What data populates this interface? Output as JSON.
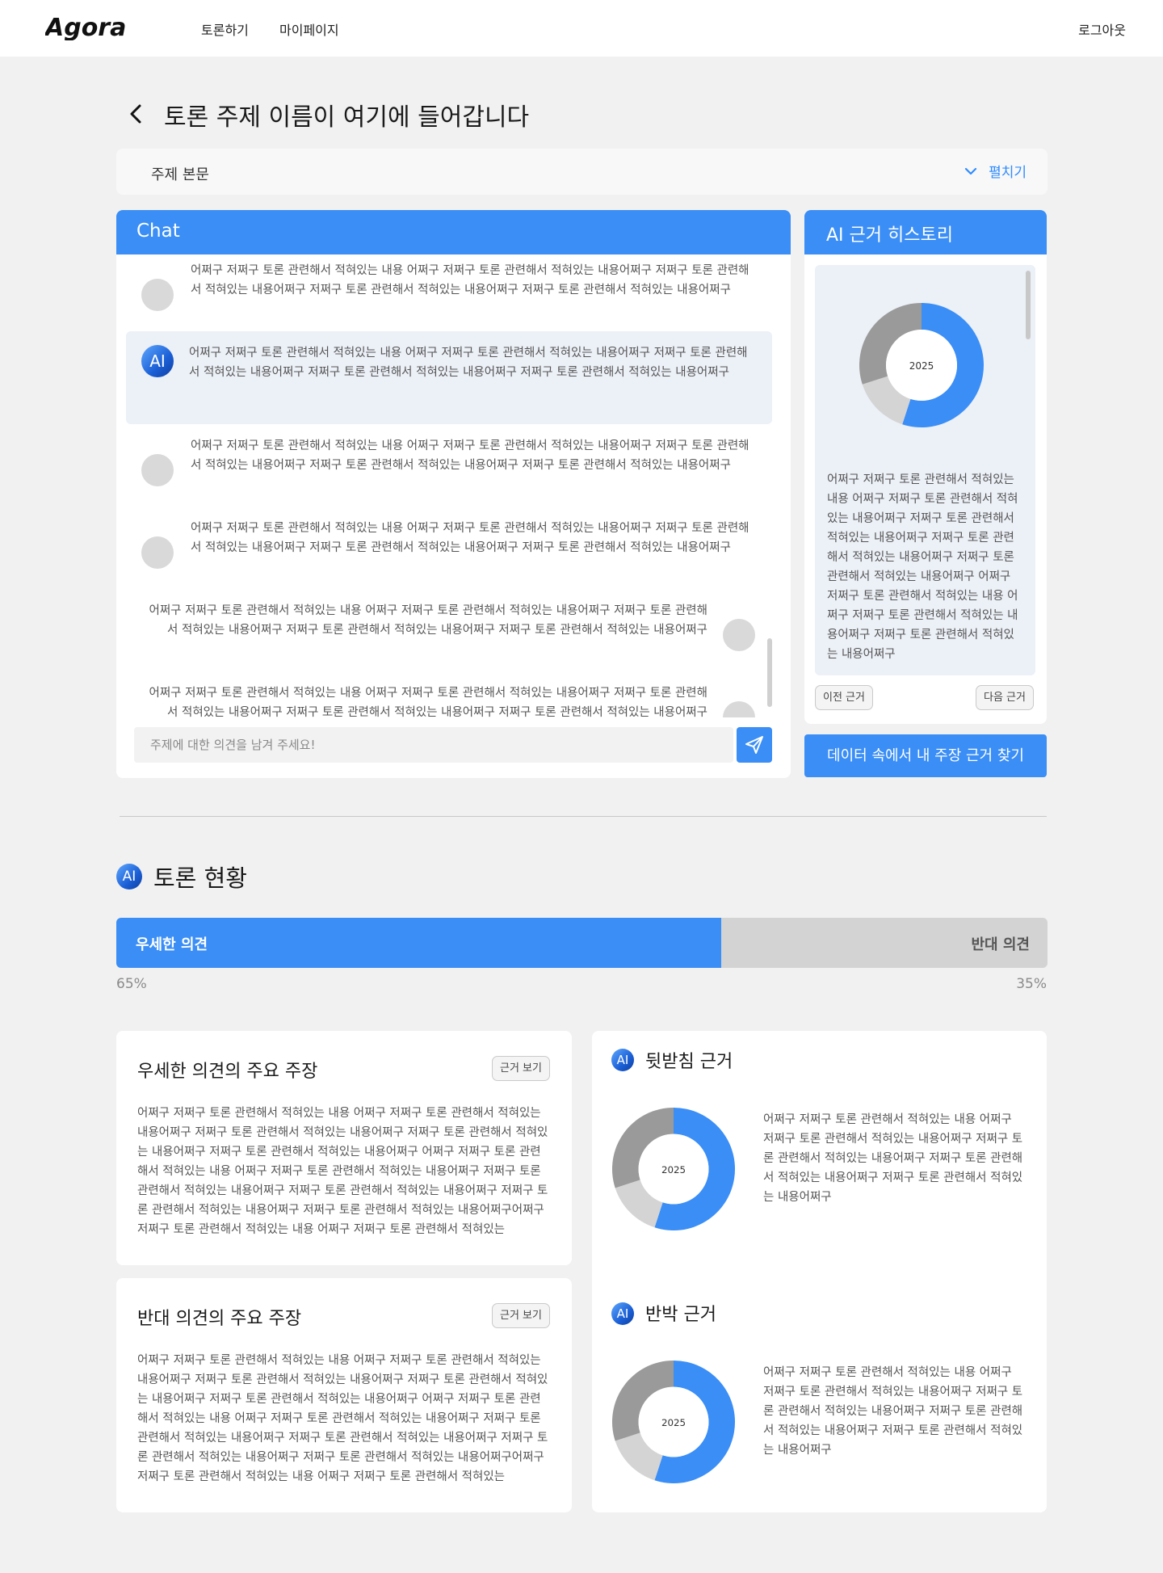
{
  "header": {
    "logo_text": "Agora",
    "nav": [
      "토론하기",
      "마이페이지"
    ],
    "logout": "로그아웃"
  },
  "page": {
    "title": "토론 주제 이름이 여기에 들어갑니다",
    "topic_label": "주제 본문",
    "expand_label": "펼치기"
  },
  "chat": {
    "title": "Chat",
    "ai_badge": "AI",
    "messages": [
      {
        "side": "left",
        "text": "어쩌구 저쩌구 토론 관련해서 적혀있는 내용 어쩌구 저쩌구 토론 관련해서 적혀있는 내용어쩌구 저쩌구 토론 관련해서 적혀있는 내용어쩌구 저쩌구 토론 관련해서 적혀있는 내용어쩌구 저쩌구 토론 관련해서 적혀있는 내용어쩌구"
      },
      {
        "side": "ai",
        "text": "어쩌구 저쩌구 토론 관련해서 적혀있는 내용 어쩌구 저쩌구 토론 관련해서 적혀있는 내용어쩌구 저쩌구 토론 관련해서 적혀있는 내용어쩌구 저쩌구 토론 관련해서 적혀있는 내용어쩌구 저쩌구 토론 관련해서 적혀있는 내용어쩌구"
      },
      {
        "side": "left",
        "text": "어쩌구 저쩌구 토론 관련해서 적혀있는 내용 어쩌구 저쩌구 토론 관련해서 적혀있는 내용어쩌구 저쩌구 토론 관련해서 적혀있는 내용어쩌구 저쩌구 토론 관련해서 적혀있는 내용어쩌구 저쩌구 토론 관련해서 적혀있는 내용어쩌구"
      },
      {
        "side": "left",
        "text": "어쩌구 저쩌구 토론 관련해서 적혀있는 내용 어쩌구 저쩌구 토론 관련해서 적혀있는 내용어쩌구 저쩌구 토론 관련해서 적혀있는 내용어쩌구 저쩌구 토론 관련해서 적혀있는 내용어쩌구 저쩌구 토론 관련해서 적혀있는 내용어쩌구"
      },
      {
        "side": "right",
        "text": "어쩌구 저쩌구 토론 관련해서 적혀있는 내용 어쩌구 저쩌구 토론 관련해서 적혀있는 내용어쩌구 저쩌구 토론 관련해서 적혀있는 내용어쩌구 저쩌구 토론 관련해서 적혀있는 내용어쩌구 저쩌구 토론 관련해서 적혀있는 내용어쩌구"
      },
      {
        "side": "right",
        "text": "어쩌구 저쩌구 토론 관련해서 적혀있는 내용 어쩌구 저쩌구 토론 관련해서 적혀있는 내용어쩌구 저쩌구 토론 관련해서 적혀있는 내용어쩌구 저쩌구 토론 관련해서 적혀있는 내용어쩌구 저쩌구 토론 관련해서 적혀있는 내용어쩌구"
      }
    ],
    "input_placeholder": "주제에 대한 의견을 남겨 주세요!",
    "send_icon": "send-icon"
  },
  "history": {
    "title": "AI 근거 히스토리",
    "chart_label": "2025",
    "text": "어쩌구 저쩌구 토론 관련해서 적혀있는 내용 어쩌구 저쩌구 토론 관련해서 적혀있는 내용어쩌구 저쩌구 토론 관련해서 적혀있는 내용어쩌구 저쩌구 토론 관련해서 적혀있는 내용어쩌구 저쩌구 토론 관련해서 적혀있는 내용어쩌구 어쩌구 저쩌구 토론 관련해서 적혀있는 내용 어쩌구 저쩌구 토론 관련해서 적혀있는 내용어쩌구 저쩌구 토론 관련해서 적혀있는 내용어쩌구",
    "prev_label": "이전 근거",
    "next_label": "다음 근거",
    "find_button": "데이터 속에서 내 주장 근거 찾기"
  },
  "status": {
    "ai_badge": "AI",
    "title": "토론 현황",
    "dominant_label": "우세한 의견",
    "opposing_label": "반대 의견",
    "dominant_pct": "65%",
    "opposing_pct": "35%",
    "dominant_fraction": 0.65
  },
  "claims": [
    {
      "title": "우세한 의견의 주요 주장",
      "button": "근거 보기",
      "text": "어쩌구 저쩌구 토론 관련해서 적혀있는 내용 어쩌구 저쩌구 토론 관련해서 적혀있는 내용어쩌구 저쩌구 토론 관련해서 적혀있는 내용어쩌구 저쩌구 토론 관련해서 적혀있는 내용어쩌구 저쩌구 토론 관련해서 적혀있는 내용어쩌구 어쩌구 저쩌구 토론 관련해서 적혀있는 내용 어쩌구 저쩌구 토론 관련해서 적혀있는 내용어쩌구 저쩌구 토론 관련해서 적혀있는 내용어쩌구 저쩌구 토론 관련해서 적혀있는 내용어쩌구 저쩌구 토론 관련해서 적혀있는 내용어쩌구 저쩌구 토론 관련해서 적혀있는 내용어쩌구어쩌구 저쩌구 토론 관련해서 적혀있는 내용 어쩌구 저쩌구 토론 관련해서 적혀있는"
    },
    {
      "title": "반대 의견의 주요 주장",
      "button": "근거 보기",
      "text": "어쩌구 저쩌구 토론 관련해서 적혀있는 내용 어쩌구 저쩌구 토론 관련해서 적혀있는 내용어쩌구 저쩌구 토론 관련해서 적혀있는 내용어쩌구 저쩌구 토론 관련해서 적혀있는 내용어쩌구 저쩌구 토론 관련해서 적혀있는 내용어쩌구 어쩌구 저쩌구 토론 관련해서 적혀있는 내용 어쩌구 저쩌구 토론 관련해서 적혀있는 내용어쩌구 저쩌구 토론 관련해서 적혀있는 내용어쩌구 저쩌구 토론 관련해서 적혀있는 내용어쩌구 저쩌구 토론 관련해서 적혀있는 내용어쩌구 저쩌구 토론 관련해서 적혀있는 내용어쩌구어쩌구 저쩌구 토론 관련해서 적혀있는 내용 어쩌구 저쩌구 토론 관련해서 적혀있는"
    }
  ],
  "evidence": [
    {
      "ai_badge": "AI",
      "title": "뒷받침 근거",
      "chart_label": "2025",
      "text": "어쩌구 저쩌구 토론 관련해서 적혀있는 내용 어쩌구 저쩌구 토론 관련해서 적혀있는 내용어쩌구 저쩌구 토론 관련해서 적혀있는 내용어쩌구 저쩌구 토론 관련해서 적혀있는 내용어쩌구 저쩌구 토론 관련해서 적혀있는 내용어쩌구"
    },
    {
      "ai_badge": "AI",
      "title": "반박 근거",
      "chart_label": "2025",
      "text": "어쩌구 저쩌구 토론 관련해서 적혀있는 내용 어쩌구 저쩌구 토론 관련해서 적혀있는 내용어쩌구 저쩌구 토론 관련해서 적혀있는 내용어쩌구 저쩌구 토론 관련해서 적혀있는 내용어쩌구 저쩌구 토론 관련해서 적혀있는 내용어쩌구"
    }
  ],
  "chart_data": {
    "type": "pie",
    "title": "2025",
    "values": [
      55,
      15,
      30
    ],
    "colors": [
      "#3a8ef6",
      "#d4d4d4",
      "#9a9a9a"
    ]
  }
}
